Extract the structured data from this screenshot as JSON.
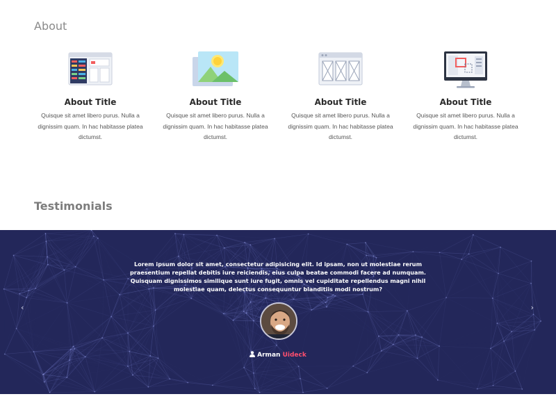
{
  "about": {
    "heading": "About",
    "cards": [
      {
        "icon": "dashboard-icon",
        "title": "About Title",
        "text": "Quisque sit amet libero purus. Nulla a dignissim quam. In hac habitasse platea dictumst."
      },
      {
        "icon": "image-icon",
        "title": "About Title",
        "text": "Quisque sit amet libero purus. Nulla a dignissim quam. In hac habitasse platea dictumst."
      },
      {
        "icon": "wireframe-icon",
        "title": "About Title",
        "text": "Quisque sit amet libero purus. Nulla a dignissim quam. In hac habitasse platea dictumst."
      },
      {
        "icon": "monitor-icon",
        "title": "About Title",
        "text": "Quisque sit amet libero purus. Nulla a dignissim quam. In hac habitasse platea dictumst."
      }
    ]
  },
  "testimonials": {
    "heading": "Testimonials",
    "quote": "Lorem ipsum dolor sit amet, consectetur adipisicing elit. Id ipsam, non ut molestiae rerum praesentium repellat debitis iure reiciendis, eius culpa beatae commodi facere ad numquam. Quisquam dignissimos similique sunt iure fugit, omnis vel cupiditate repellendus magni nihil molestiae quam, delectus consequuntur blanditiis modi nostrum?",
    "author_first": "Arman",
    "author_last": "Uideck",
    "prev_label": "‹",
    "next_label": "›",
    "colors": {
      "band": "#23275a",
      "accent": "#ff4f6e"
    }
  }
}
